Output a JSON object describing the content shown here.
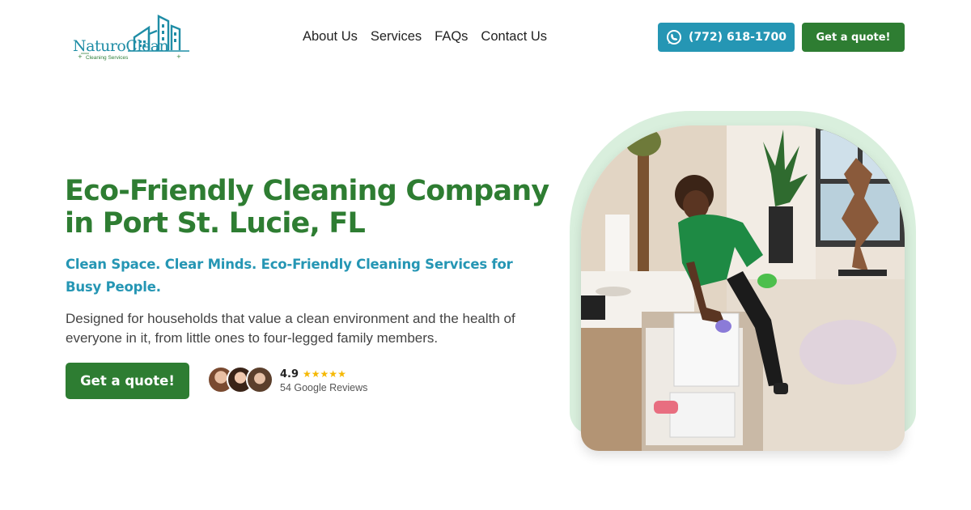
{
  "logo": {
    "word": "Natur",
    "word_o": "o",
    "word_end": "Clean",
    "tagline": "Cleaning Services",
    "icon": "buildings-icon",
    "color_primary": "#1f8da6",
    "color_secondary": "#2e7f3a"
  },
  "nav": {
    "items": [
      {
        "label": "About Us"
      },
      {
        "label": "Services"
      },
      {
        "label": "FAQs"
      },
      {
        "label": "Contact Us"
      }
    ]
  },
  "header": {
    "phone_label": "(772) 618-1700",
    "phone_icon": "phone-chat-icon",
    "quote_label": "Get a quote!"
  },
  "hero": {
    "title": "Eco-Friendly Cleaning Company in Port St. Lucie, FL",
    "subtitle": "Clean Space. Clear Minds. Eco-Friendly Cleaning Services for Busy People.",
    "description": "Designed for households that value a clean environment and the health of everyone in it, from little ones to four-legged family members.",
    "cta_label": "Get a quote!",
    "rating_value": "4.9",
    "stars": "★★★★★",
    "review_count": "54 Google Reviews"
  },
  "colors": {
    "brand_green": "#2e7d32",
    "brand_blue": "#2596b4",
    "frame_green": "#d9efdd",
    "star_gold": "#f5b800"
  }
}
